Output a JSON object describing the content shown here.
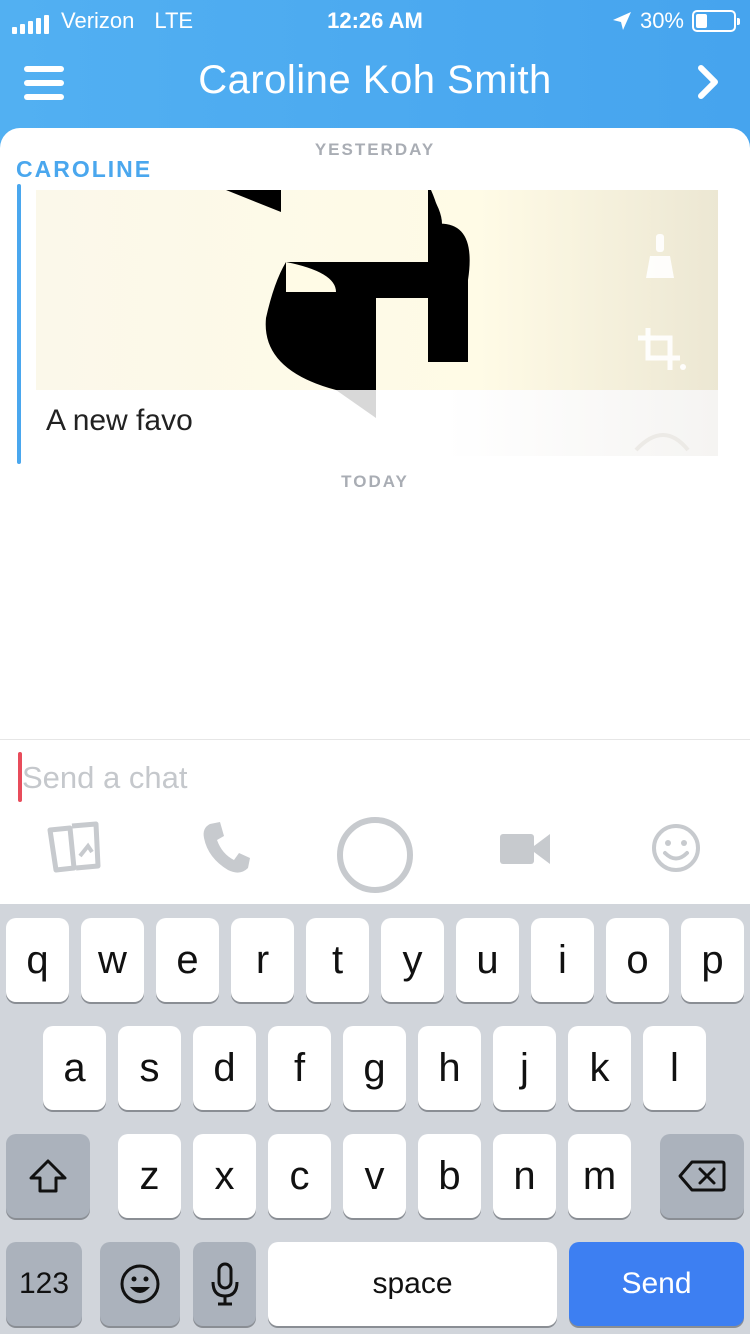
{
  "status_bar": {
    "carrier": "Verizon",
    "network": "LTE",
    "time": "12:26 AM",
    "battery_percent": "30%",
    "battery_level": 0.3
  },
  "header": {
    "title": "Caroline Koh Smith",
    "menu_icon": "hamburger-menu-icon",
    "forward_icon": "chevron-right-icon"
  },
  "chat": {
    "yesterday_label": "YESTERDAY",
    "sender": "CAROLINE",
    "message_caption": "A new favo",
    "today_label": "TODAY"
  },
  "composer": {
    "placeholder": "Send a chat",
    "value": ""
  },
  "actions": [
    {
      "name": "memories-icon"
    },
    {
      "name": "phone-icon"
    },
    {
      "name": "capture-button"
    },
    {
      "name": "video-icon"
    },
    {
      "name": "emoji-icon"
    }
  ],
  "keyboard": {
    "row1": [
      "q",
      "w",
      "e",
      "r",
      "t",
      "y",
      "u",
      "i",
      "o",
      "p"
    ],
    "row2": [
      "a",
      "s",
      "d",
      "f",
      "g",
      "h",
      "j",
      "k",
      "l"
    ],
    "row3": [
      "z",
      "x",
      "c",
      "v",
      "b",
      "n",
      "m"
    ],
    "numbers_label": "123",
    "space_label": "space",
    "send_label": "Send"
  },
  "colors": {
    "header_blue": "#4aa7ee",
    "send_blue": "#3d7ff2",
    "cursor_red": "#e84c5b",
    "keyboard_bg": "#d1d5db"
  }
}
